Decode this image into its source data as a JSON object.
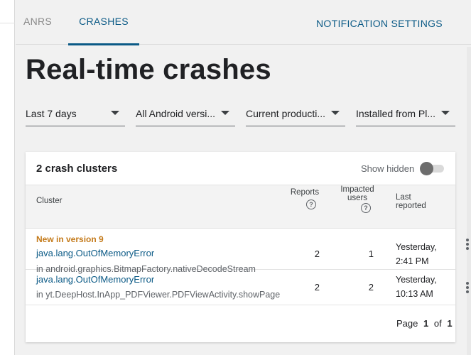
{
  "tabs": [
    {
      "label": "ANRS",
      "active": false
    },
    {
      "label": "CRASHES",
      "active": true
    }
  ],
  "header": {
    "notification_settings": "NOTIFICATION SETTINGS"
  },
  "page": {
    "title": "Real-time crashes"
  },
  "filters": [
    {
      "label": "Last 7 days",
      "icon": "chevron-down-icon"
    },
    {
      "label": "All Android versi...",
      "icon": "chevron-down-icon"
    },
    {
      "label": "Current producti...",
      "icon": "chevron-down-icon"
    },
    {
      "label": "Installed from Pl...",
      "icon": "chevron-down-icon"
    }
  ],
  "card": {
    "cluster_count": "2 crash clusters",
    "show_hidden_label": "Show hidden",
    "show_hidden_enabled": false,
    "columns": {
      "cluster": "Cluster",
      "reports": "Reports",
      "impacted_users_line1": "Impacted",
      "impacted_users_line2": "users",
      "last_reported_line1": "Last",
      "last_reported_line2": "reported"
    },
    "help_icon_glyph": "?",
    "rows": [
      {
        "badge": "New in version 9",
        "error": "java.lang.OutOfMemoryError",
        "location": "in android.graphics.BitmapFactory.nativeDecodeStream",
        "reports": "2",
        "impacted_users": "1",
        "last_reported_line1": "Yesterday,",
        "last_reported_line2": "2:41 PM"
      },
      {
        "badge": "",
        "error": "java.lang.OutOfMemoryError",
        "location": "in yt.DeepHost.InApp_PDFViewer.PDFViewActivity.showPage",
        "reports": "2",
        "impacted_users": "2",
        "last_reported_line1": "Yesterday,",
        "last_reported_line2": "10:13 AM"
      }
    ],
    "pager": {
      "prefix": "Page",
      "current": "1",
      "separator": "of",
      "total": "1"
    }
  },
  "colors": {
    "accent": "#0b5a86",
    "badge": "#c47a1a",
    "background": "#f1f1f1"
  }
}
